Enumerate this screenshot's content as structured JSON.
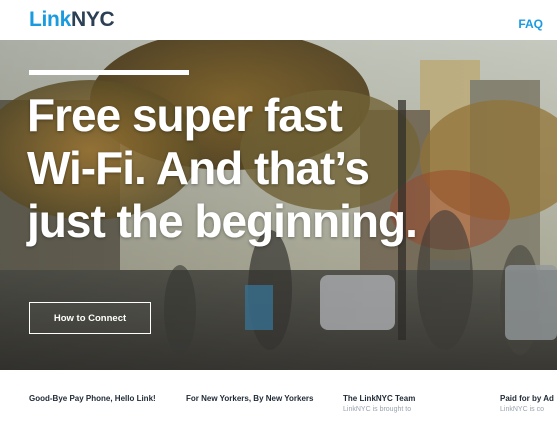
{
  "header": {
    "logo_part1": "Link",
    "logo_part2": "NYC",
    "faq_label": "FAQ"
  },
  "hero": {
    "headline_lines": [
      "Free super fast",
      "Wi-Fi. And that’s",
      "just the beginning."
    ],
    "button_label": "How to Connect"
  },
  "cards": [
    {
      "title": "Good-Bye Pay Phone, Hello Link!",
      "text": ""
    },
    {
      "title": "For New Yorkers, By New Yorkers",
      "text": ""
    },
    {
      "title": "The LinkNYC Team",
      "text": "LinkNYC is brought to"
    },
    {
      "title": "Paid for by Ad",
      "text": "LinkNYC is co"
    }
  ],
  "colors": {
    "brand_blue": "#1a9be0",
    "brand_dark": "#2b3f55",
    "hero_text": "#ffffff"
  }
}
